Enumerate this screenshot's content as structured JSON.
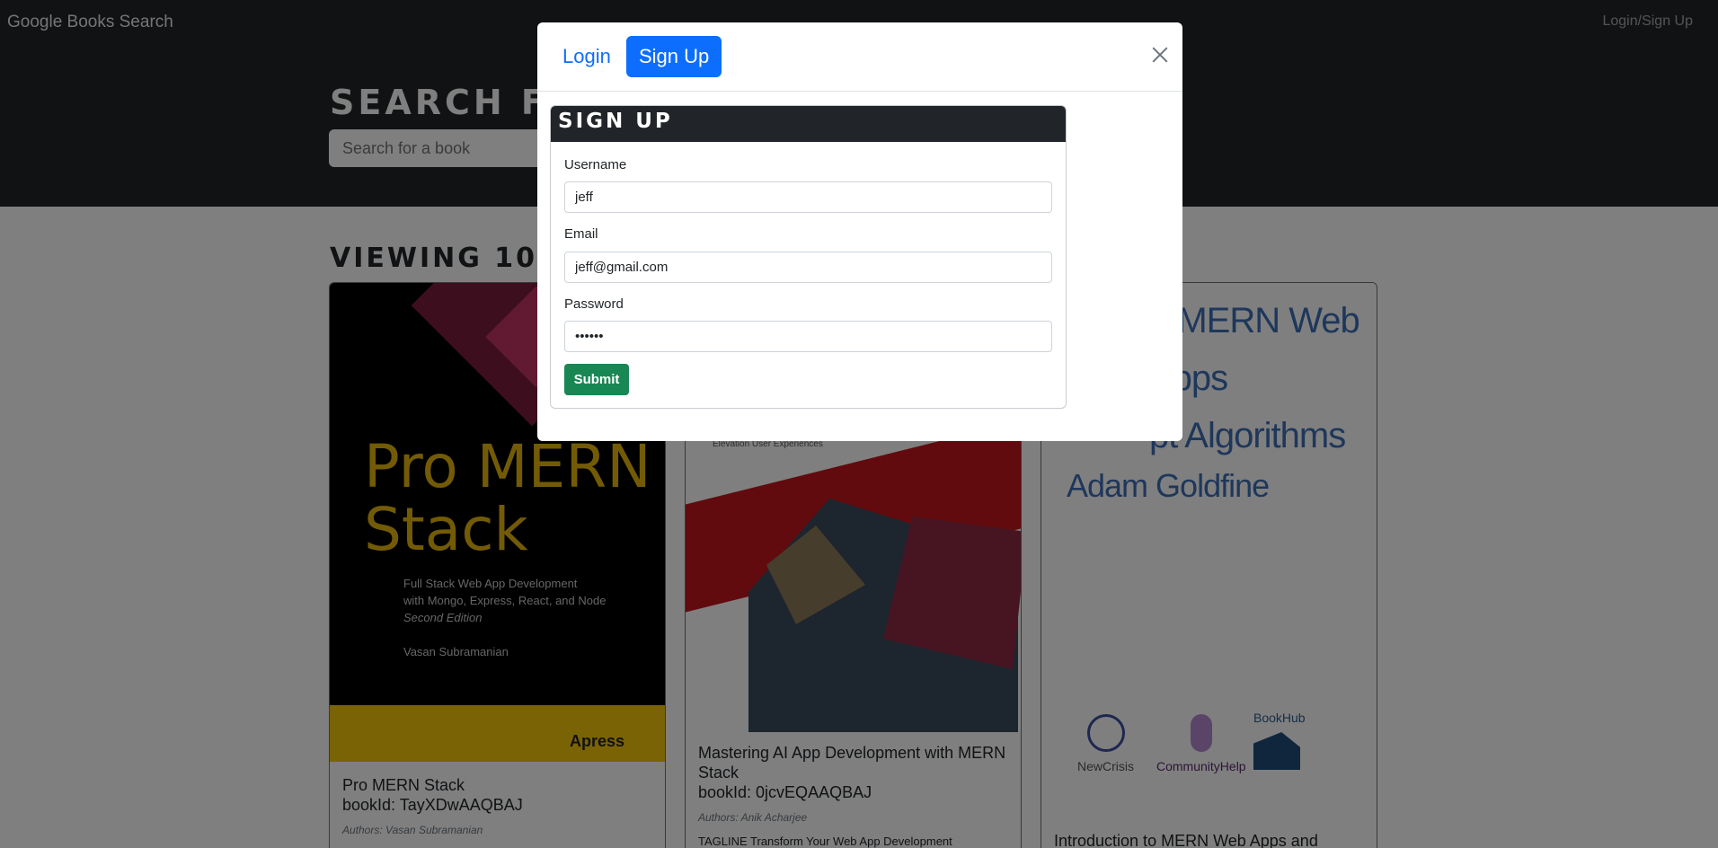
{
  "navbar": {
    "brand": "Google Books Search",
    "login_link": "Login/Sign Up"
  },
  "hero": {
    "title": "SEARCH F",
    "search_placeholder": "Search for a book"
  },
  "results": {
    "heading": "VIEWING 10",
    "books": [
      {
        "title": "Pro MERN Stack",
        "book_id_line": "bookId: TayXDwAAQBAJ",
        "authors": "Authors: Vasan Subramanian",
        "cover": {
          "title_line1": "Pro MERN",
          "title_line2": "Stack",
          "sub1": "Full Stack Web App Development",
          "sub2": "with Mongo, Express, React, and Node",
          "edition": "Second Edition",
          "author": "Vasan Subramanian",
          "publisher": "Apress"
        }
      },
      {
        "title": "Mastering AI App Development with MERN Stack",
        "book_id_line": "bookId: 0jcvEQAAQBAJ",
        "authors": "Authors: Anik Acharjee",
        "description": "TAGLINE Transform Your Web App Development",
        "cover": {
          "caption": "Elevation User Experiences"
        }
      },
      {
        "title": "Introduction to MERN Web Apps and",
        "cover": {
          "line1": "o MERN Web Apps",
          "line2": "pt Algorithms",
          "author": "Adam Goldfine",
          "logo1": "NewCrisis",
          "logo2": "CommunityHelp",
          "logo3": "BookHub"
        }
      }
    ]
  },
  "modal": {
    "tabs": {
      "login": "Login",
      "signup": "Sign Up"
    },
    "form": {
      "heading": "SIGN UP",
      "username_label": "Username",
      "username_value": "jeff",
      "email_label": "Email",
      "email_value": "jeff@gmail.com",
      "password_label": "Password",
      "password_value": "••••••",
      "submit_label": "Submit"
    }
  },
  "colors": {
    "navbar_bg": "#212529",
    "primary": "#0d6efd",
    "success": "#198754",
    "overlay": "rgba(0,0,0,0.5)"
  }
}
